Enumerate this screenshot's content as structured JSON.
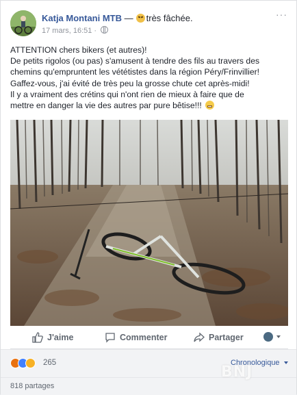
{
  "post": {
    "author": "Katja Montani MTB",
    "feeling": "très fâchée.",
    "timestamp": "17 mars, 16:51 ·",
    "text_lines": [
      "ATTENTION chers bikers (et autres)!",
      "De petits rigolos (ou pas) s'amusent à tendre des fils au travers des",
      "chemins qu'empruntent les vététistes dans la région Péry/Frinvillier!",
      "Gaffez-vous, j'ai évité de très peu la grosse chute cet après-midi!",
      "Il y a vraiment des crétins qui n'ont rien de mieux à faire que de",
      "mettre en danger la vie des autres par pure bêtise!!!"
    ],
    "icons": {
      "feeling": "angry-face-icon",
      "audience": "globe-icon",
      "options": "more-options-icon",
      "text_emoji": "screaming-face-icon"
    }
  },
  "actions": {
    "like_label": "J'aime",
    "comment_label": "Commenter",
    "share_label": "Partager"
  },
  "reactions": {
    "count": "265",
    "types": [
      "angry",
      "like",
      "wow"
    ],
    "colors": {
      "angry": "#e9710f",
      "like": "#4080ff",
      "wow": "#f7b125"
    }
  },
  "comments": {
    "order_label": "Chronologique"
  },
  "shares": {
    "label": "818 partages"
  },
  "watermark": "BNJ",
  "colors": {
    "link": "#365899",
    "text": "#1d2129",
    "muted": "#90949c",
    "background": "#e9ebee"
  }
}
